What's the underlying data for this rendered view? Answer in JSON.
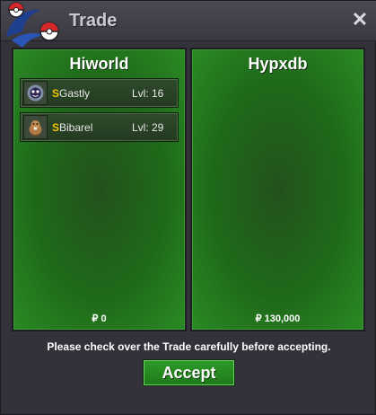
{
  "window": {
    "title": "Trade",
    "close_glyph": "✕",
    "logo_icon": "pokeball-logo-icon"
  },
  "left_panel": {
    "name": "Hiworld",
    "pokemon": [
      {
        "money_glyph": "S",
        "name": "Gastly",
        "level": "Lvl: 16",
        "icon": "gastly-sprite-icon"
      },
      {
        "money_glyph": "S",
        "name": "Bibarel",
        "level": "Lvl: 29",
        "icon": "bibarel-sprite-icon"
      }
    ],
    "money": "₽ 0"
  },
  "right_panel": {
    "name": "Hypxdb",
    "money": "₽ 130,000"
  },
  "footer": {
    "notice": "Please check over the Trade carefully before accepting.",
    "accept_label": "Accept"
  },
  "colors": {
    "panel_green": "#1f6a1a",
    "accept_green": "#2e9a28",
    "money_yellow": "#f2c300"
  }
}
